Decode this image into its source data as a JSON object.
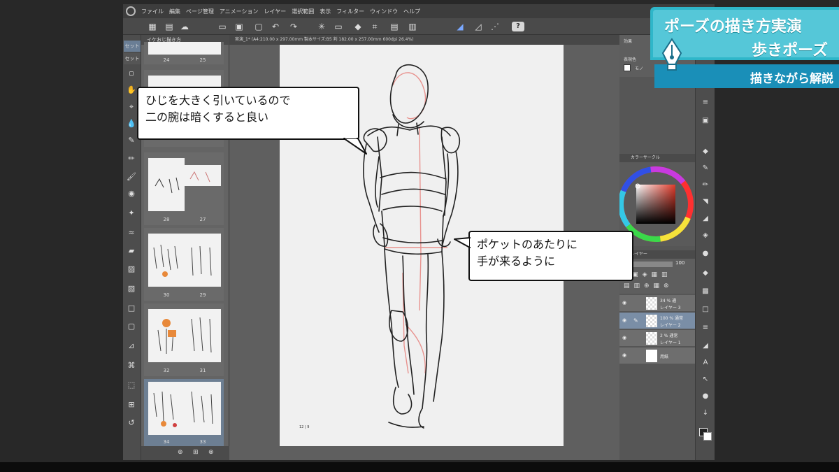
{
  "menu": {
    "items": [
      "ファイル",
      "編集",
      "ページ管理",
      "アニメーション",
      "レイヤー",
      "選択範囲",
      "表示",
      "フィルター",
      "ウィンドウ",
      "ヘルプ"
    ]
  },
  "left_tools": {
    "tab1": "セット",
    "tab2": "セット"
  },
  "pages": {
    "header": "イケおじ描き方",
    "items": [
      {
        "left": "24",
        "right": "25"
      },
      {
        "left": "26",
        "right": "27"
      },
      {
        "left": "28",
        "right": "27"
      },
      {
        "left": "30",
        "right": "29"
      },
      {
        "left": "32",
        "right": "31"
      },
      {
        "left": "34",
        "right": "33"
      }
    ]
  },
  "document": {
    "tab_label": "実演_1* (A4:210.00 x 297.00mm 製本サイズ:B5 判 182.00 x 257.00mm 600dpi 26.4%)",
    "page_number": "12 | 9"
  },
  "right_panel": {
    "effect_label": "効果",
    "display_color_label": "表現色",
    "mono_label": "モノ",
    "color_circle_label": "カラーサークル",
    "layer_label": "レイヤー",
    "opacity_value": "100",
    "layers": [
      {
        "mode": "34 % 通",
        "name": "レイヤー 3"
      },
      {
        "mode": "100 % 通常",
        "name": "レイヤー 2"
      },
      {
        "mode": "2 % 通常",
        "name": "レイヤー 1"
      },
      {
        "mode": "",
        "name": "用紙"
      }
    ]
  },
  "callouts": {
    "elbow_line1": "ひじを大きく引いているので",
    "elbow_line2": "二の腕は暗くすると良い",
    "pocket_line1": "ポケットのあたりに",
    "pocket_line2": "手が来るように"
  },
  "title": {
    "line1": "ポーズの描き方実演",
    "line2": "歩きポーズ",
    "sub": "描きながら解説"
  },
  "colors": {
    "title_bg": "#55c7d8",
    "title_sub_bg": "#1a8fb8",
    "selected_page": "#6d7f93",
    "active_layer": "#7a8ea6"
  }
}
